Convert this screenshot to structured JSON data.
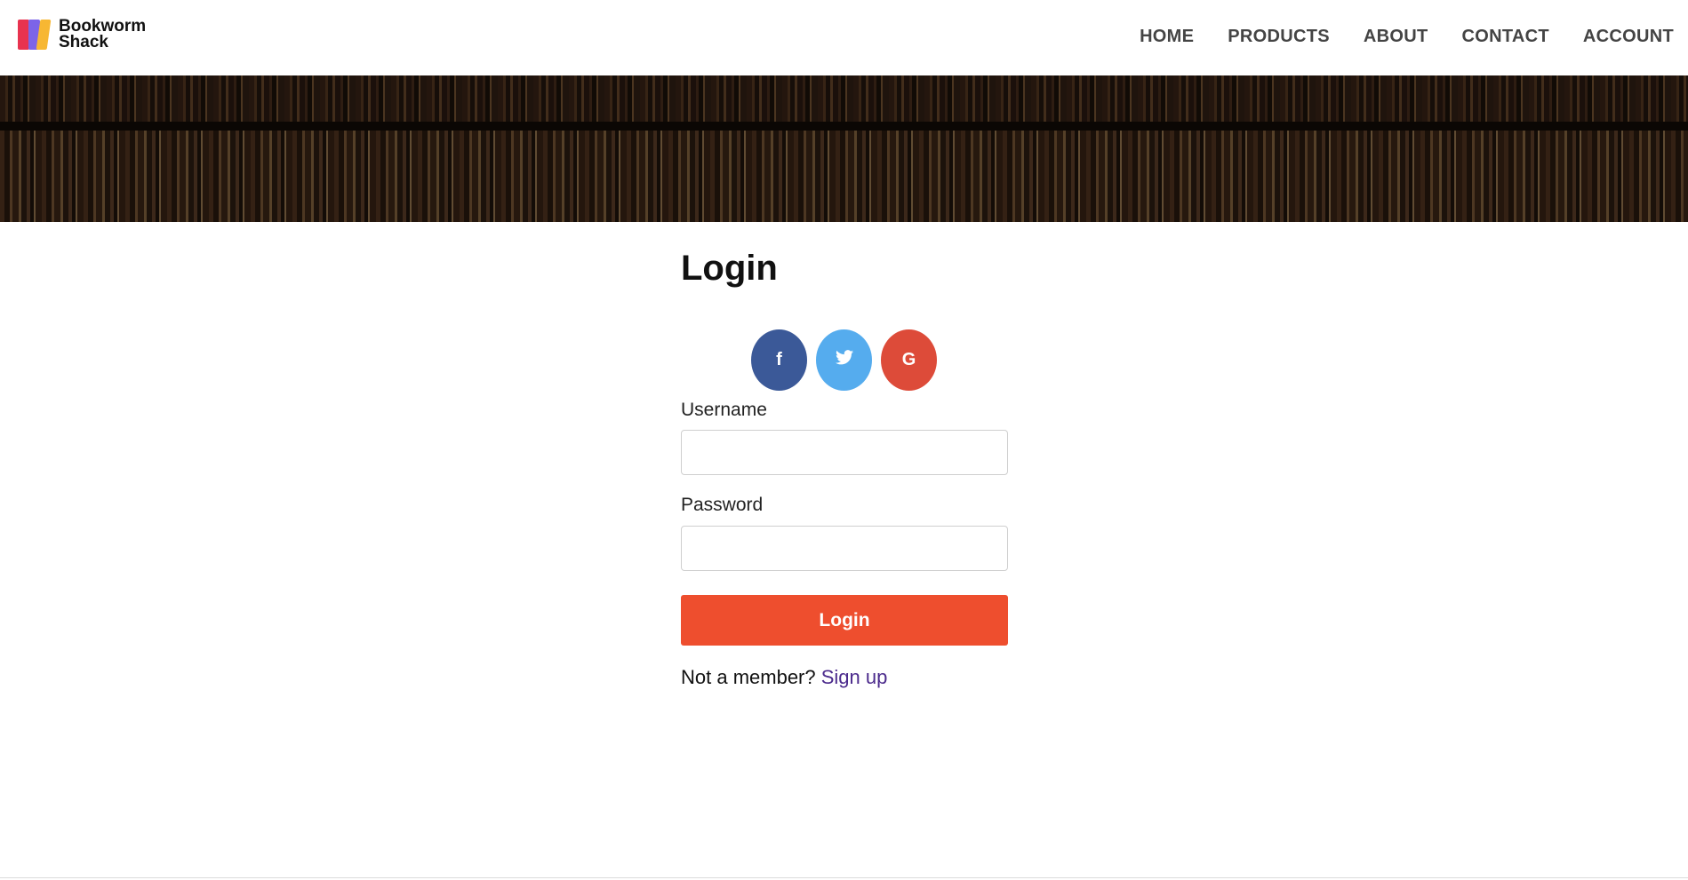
{
  "brand": {
    "line1": "Bookworm",
    "line2": "Shack"
  },
  "nav": [
    {
      "label": "HOME"
    },
    {
      "label": "PRODUCTS"
    },
    {
      "label": "ABOUT"
    },
    {
      "label": "CONTACT"
    },
    {
      "label": "ACCOUNT"
    }
  ],
  "login": {
    "title": "Login",
    "social": [
      {
        "glyph": "f",
        "icon": "facebook-icon",
        "color": "#3b5998"
      },
      {
        "glyph": "🐦",
        "icon": "twitter-icon",
        "color": "#55acee"
      },
      {
        "glyph": "G",
        "icon": "google-icon",
        "color": "#dd4b39"
      }
    ],
    "username_label": "Username",
    "username_value": "",
    "password_label": "Password",
    "password_value": "",
    "submit_label": "Login",
    "signup_prompt": "Not a member?",
    "signup_link": "Sign up"
  },
  "colors": {
    "accent": "#ee4e2e",
    "link": "#4b2a8c",
    "facebook": "#3b5998",
    "twitter": "#55acee",
    "google": "#dd4b39"
  }
}
